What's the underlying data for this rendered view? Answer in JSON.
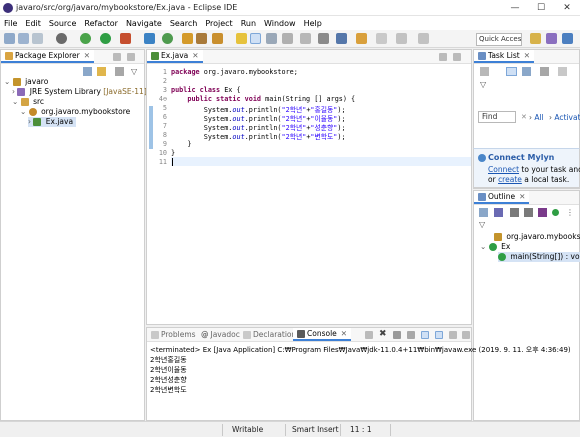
{
  "window": {
    "title": "javaro/src/org/javaro/mybookstore/Ex.java - Eclipse IDE",
    "minimize": "—",
    "maximize": "☐",
    "close": "✕"
  },
  "menu": [
    "File",
    "Edit",
    "Source",
    "Refactor",
    "Navigate",
    "Search",
    "Project",
    "Run",
    "Window",
    "Help"
  ],
  "toolbar": {
    "quick_access": "Quick Access"
  },
  "package_explorer": {
    "tab": "Package Explorer",
    "close": "✕",
    "tree": {
      "project": "javaro",
      "jre": "JRE System Library",
      "jre_version": "[JavaSE-11]",
      "src": "src",
      "package": "org.javaro.mybookstore",
      "file": "Ex.java"
    }
  },
  "editor": {
    "tab": "Ex.java",
    "close": "✕",
    "line_numbers": [
      "1",
      "2",
      "3",
      "4⊖",
      "5",
      "6",
      "7",
      "8",
      "9",
      "10",
      "11"
    ]
  },
  "code": {
    "l1_kw": "package",
    "l1_rest": " org.javaro.mybookstore;",
    "l3_kw": "public class",
    "l3_rest": " Ex {",
    "l4_kw": "    public static void",
    "l4_rest": " main(String [] args) {",
    "println_prefix": "        System.",
    "out": "out",
    "println_mid": ".println(",
    "s_prefix": "\"2학년\"",
    "plus": "+",
    "names": [
      "\"홍길동\"",
      "\"이율동\"",
      "\"성춘향\"",
      "\"변학도\""
    ],
    "println_end": ");",
    "l9": "    }",
    "l10": "}"
  },
  "task_list": {
    "tab": "Task List",
    "close": "✕",
    "find_placeholder": "Find",
    "all": "All",
    "activate": "Activate..."
  },
  "mylyn": {
    "title": "Connect Mylyn",
    "connect": "Connect",
    "to_task": " to your task and AL",
    "or": "or ",
    "create": "create",
    "local": " a local task."
  },
  "outline": {
    "tab": "Outline",
    "close": "✕",
    "package": "org.javaro.mybookstore",
    "class": "Ex",
    "method": "main(String[]) : void"
  },
  "bottom_tabs": [
    "Problems",
    "Javadoc",
    "Declaration",
    "Console"
  ],
  "console": {
    "header": "<terminated> Ex [Java Application] C:₩Program Files₩Java₩jdk-11.0.4+11₩bin₩javaw.exe (2019. 9. 11. 오후 4:36:49)",
    "lines": [
      "2학년홍길동",
      "2학년이율동",
      "2학년성춘향",
      "2학년변학도"
    ]
  },
  "status": {
    "writable": "Writable",
    "insert_mode": "Smart Insert",
    "position": "11 : 1"
  },
  "colors": {
    "accent": "#3d80d6",
    "keyword": "#7f0055",
    "field": "#0000c0",
    "string": "#2a00ff"
  }
}
